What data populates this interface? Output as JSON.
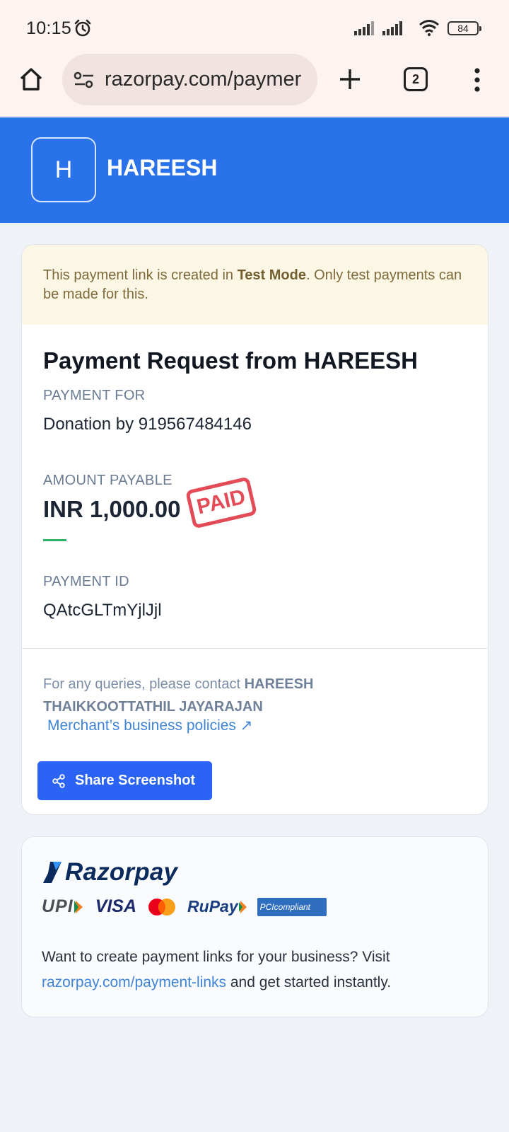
{
  "status_bar": {
    "time": "10:15",
    "battery": "84"
  },
  "browser": {
    "url": "razorpay.com/paymer",
    "tab_count": "2"
  },
  "merchant": {
    "initial": "H",
    "name": "HAREESH"
  },
  "test_banner": {
    "prefix": "This payment link is created in ",
    "mode": "Test Mode",
    "suffix": ". Only test payments can be made for this."
  },
  "payment": {
    "title": "Payment Request from HAREESH",
    "for_label": "PAYMENT FOR",
    "for_value": "Donation by 919567484146",
    "amount_label": "AMOUNT PAYABLE",
    "amount_value": "INR 1,000.00",
    "paid_stamp": "PAID",
    "id_label": "PAYMENT ID",
    "id_value": "QAtcGLTmYjlJjl"
  },
  "contact": {
    "prefix": "For any queries, please contact ",
    "name": "HAREESH THAIKKOOTTATHIL JAYARAJAN",
    "policy_link": "Merchant’s business policies ↗"
  },
  "share_button": {
    "label": "Share Screenshot"
  },
  "footer": {
    "brand": "Razorpay",
    "payment_logos": {
      "upi": "UPI",
      "visa": "VISA",
      "rupay": "RuPay",
      "pci": "PCIcompliant"
    },
    "promo_prefix": "Want to create payment links for your business? Visit ",
    "promo_link": "razorpay.com/payment-links",
    "promo_suffix": " and get started instantly."
  },
  "colors": {
    "header_blue": "#2a72ea",
    "share_button": "#2b64f5",
    "paid_red": "#e34b57",
    "link_blue": "#3f84d6",
    "banner_bg": "#fcf7e4"
  }
}
